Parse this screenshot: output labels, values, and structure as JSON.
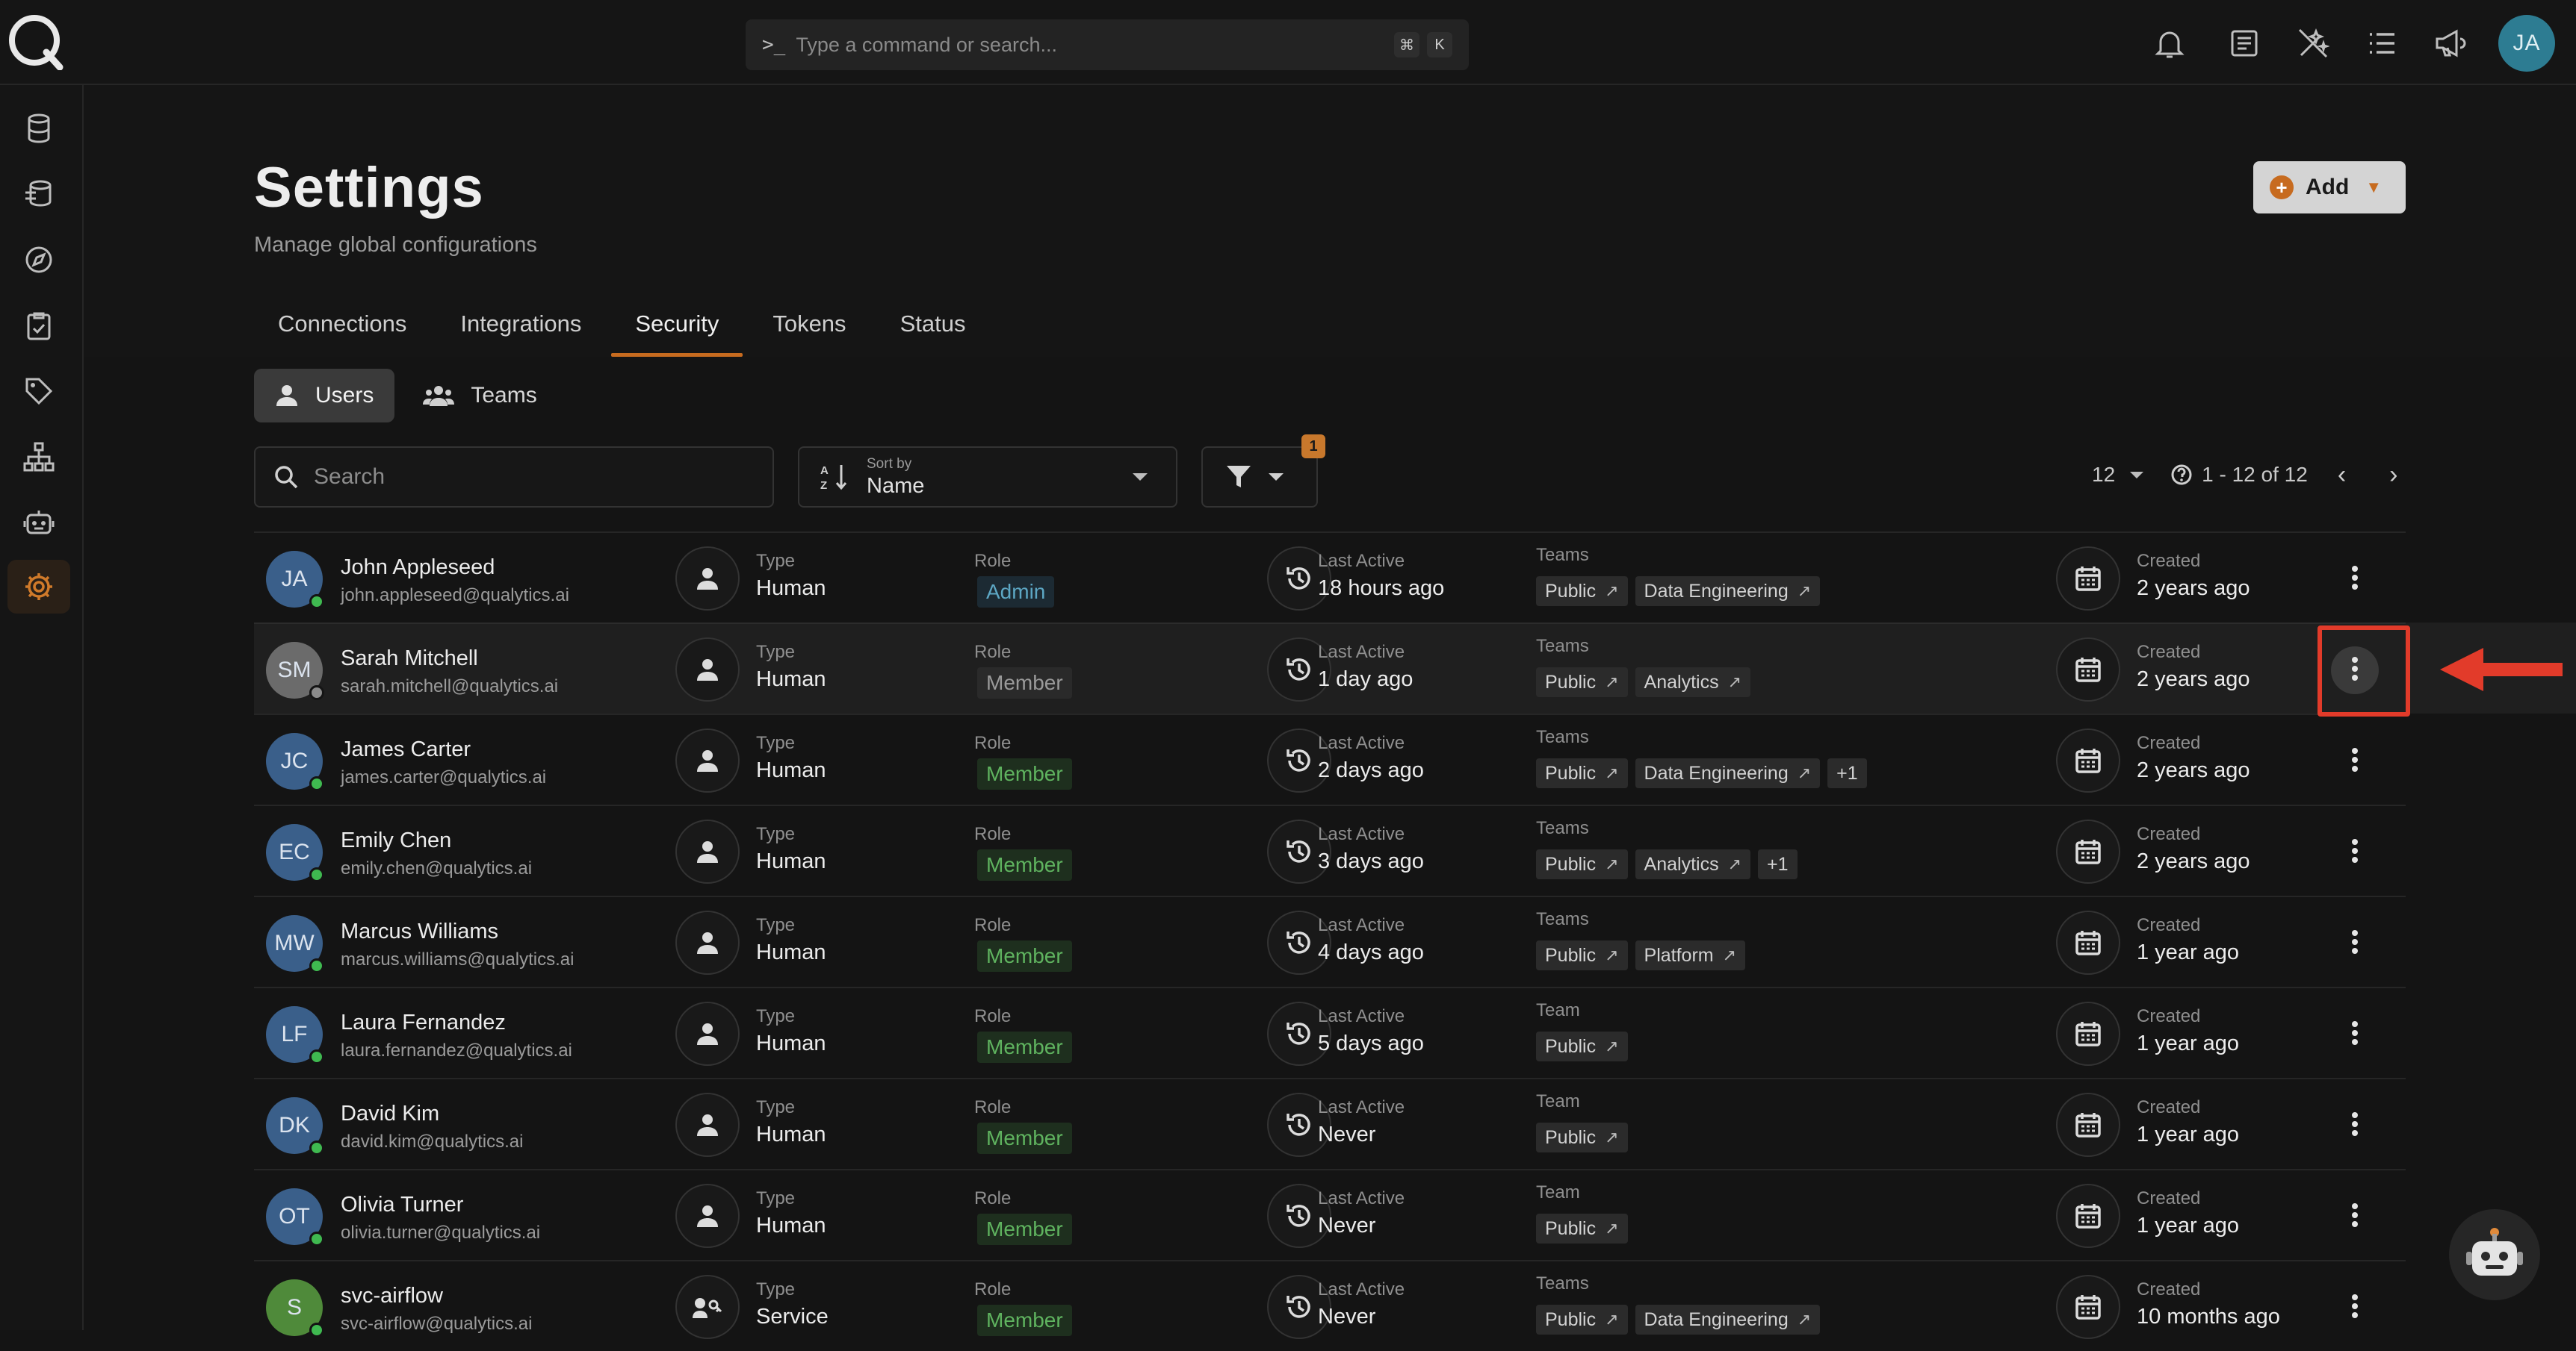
{
  "command_bar": {
    "prompt": ">_",
    "placeholder": "Type a command or search...",
    "shortcut_mod": "⌘",
    "shortcut_key": "K"
  },
  "top_avatar": "JA",
  "page": {
    "title": "Settings",
    "subtitle": "Manage global configurations",
    "add_label": "Add"
  },
  "tabs": [
    "Connections",
    "Integrations",
    "Security",
    "Tokens",
    "Status"
  ],
  "active_tab": "Security",
  "segments": [
    "Users",
    "Teams"
  ],
  "search": {
    "placeholder": "Search"
  },
  "sort": {
    "label": "Sort by",
    "value": "Name"
  },
  "filter": {
    "badge": "1"
  },
  "pagination": {
    "page_size": "12",
    "range": "1 - 12 of 12"
  },
  "labels": {
    "type": "Type",
    "role": "Role",
    "last_active": "Last Active",
    "teams": "Teams",
    "team": "Team",
    "created": "Created"
  },
  "users": [
    {
      "initials": "JA",
      "name": "John Appleseed",
      "email": "john.appleseed@qualytics.ai",
      "type": "Human",
      "role": "Admin",
      "last_active": "18 hours ago",
      "teams_label": "Teams",
      "teams": [
        "Public",
        "Data Engineering"
      ],
      "extra": "",
      "created": "2 years ago"
    },
    {
      "initials": "SM",
      "name": "Sarah Mitchell",
      "email": "sarah.mitchell@qualytics.ai",
      "type": "Human",
      "role": "Member",
      "last_active": "1 day ago",
      "teams_label": "Teams",
      "teams": [
        "Public",
        "Analytics"
      ],
      "extra": "",
      "created": "2 years ago"
    },
    {
      "initials": "JC",
      "name": "James Carter",
      "email": "james.carter@qualytics.ai",
      "type": "Human",
      "role": "Member",
      "last_active": "2 days ago",
      "teams_label": "Teams",
      "teams": [
        "Public",
        "Data Engineering"
      ],
      "extra": "+1",
      "created": "2 years ago"
    },
    {
      "initials": "EC",
      "name": "Emily Chen",
      "email": "emily.chen@qualytics.ai",
      "type": "Human",
      "role": "Member",
      "last_active": "3 days ago",
      "teams_label": "Teams",
      "teams": [
        "Public",
        "Analytics"
      ],
      "extra": "+1",
      "created": "2 years ago"
    },
    {
      "initials": "MW",
      "name": "Marcus Williams",
      "email": "marcus.williams@qualytics.ai",
      "type": "Human",
      "role": "Member",
      "last_active": "4 days ago",
      "teams_label": "Teams",
      "teams": [
        "Public",
        "Platform"
      ],
      "extra": "",
      "created": "1 year ago"
    },
    {
      "initials": "LF",
      "name": "Laura Fernandez",
      "email": "laura.fernandez@qualytics.ai",
      "type": "Human",
      "role": "Member",
      "last_active": "5 days ago",
      "teams_label": "Team",
      "teams": [
        "Public"
      ],
      "extra": "",
      "created": "1 year ago"
    },
    {
      "initials": "DK",
      "name": "David Kim",
      "email": "david.kim@qualytics.ai",
      "type": "Human",
      "role": "Member",
      "last_active": "Never",
      "teams_label": "Team",
      "teams": [
        "Public"
      ],
      "extra": "",
      "created": "1 year ago"
    },
    {
      "initials": "OT",
      "name": "Olivia Turner",
      "email": "olivia.turner@qualytics.ai",
      "type": "Human",
      "role": "Member",
      "last_active": "Never",
      "teams_label": "Team",
      "teams": [
        "Public"
      ],
      "extra": "",
      "created": "1 year ago"
    },
    {
      "initials": "S",
      "name": "svc-airflow",
      "email": "svc-airflow@qualytics.ai",
      "type": "Service",
      "role": "Member",
      "last_active": "Never",
      "teams_label": "Teams",
      "teams": [
        "Public",
        "Data Engineering"
      ],
      "extra": "",
      "created": "10 months ago"
    }
  ],
  "colors": {
    "accent": "#c76b1f",
    "highlight": "#e23b2a",
    "online": "#3fb950"
  }
}
